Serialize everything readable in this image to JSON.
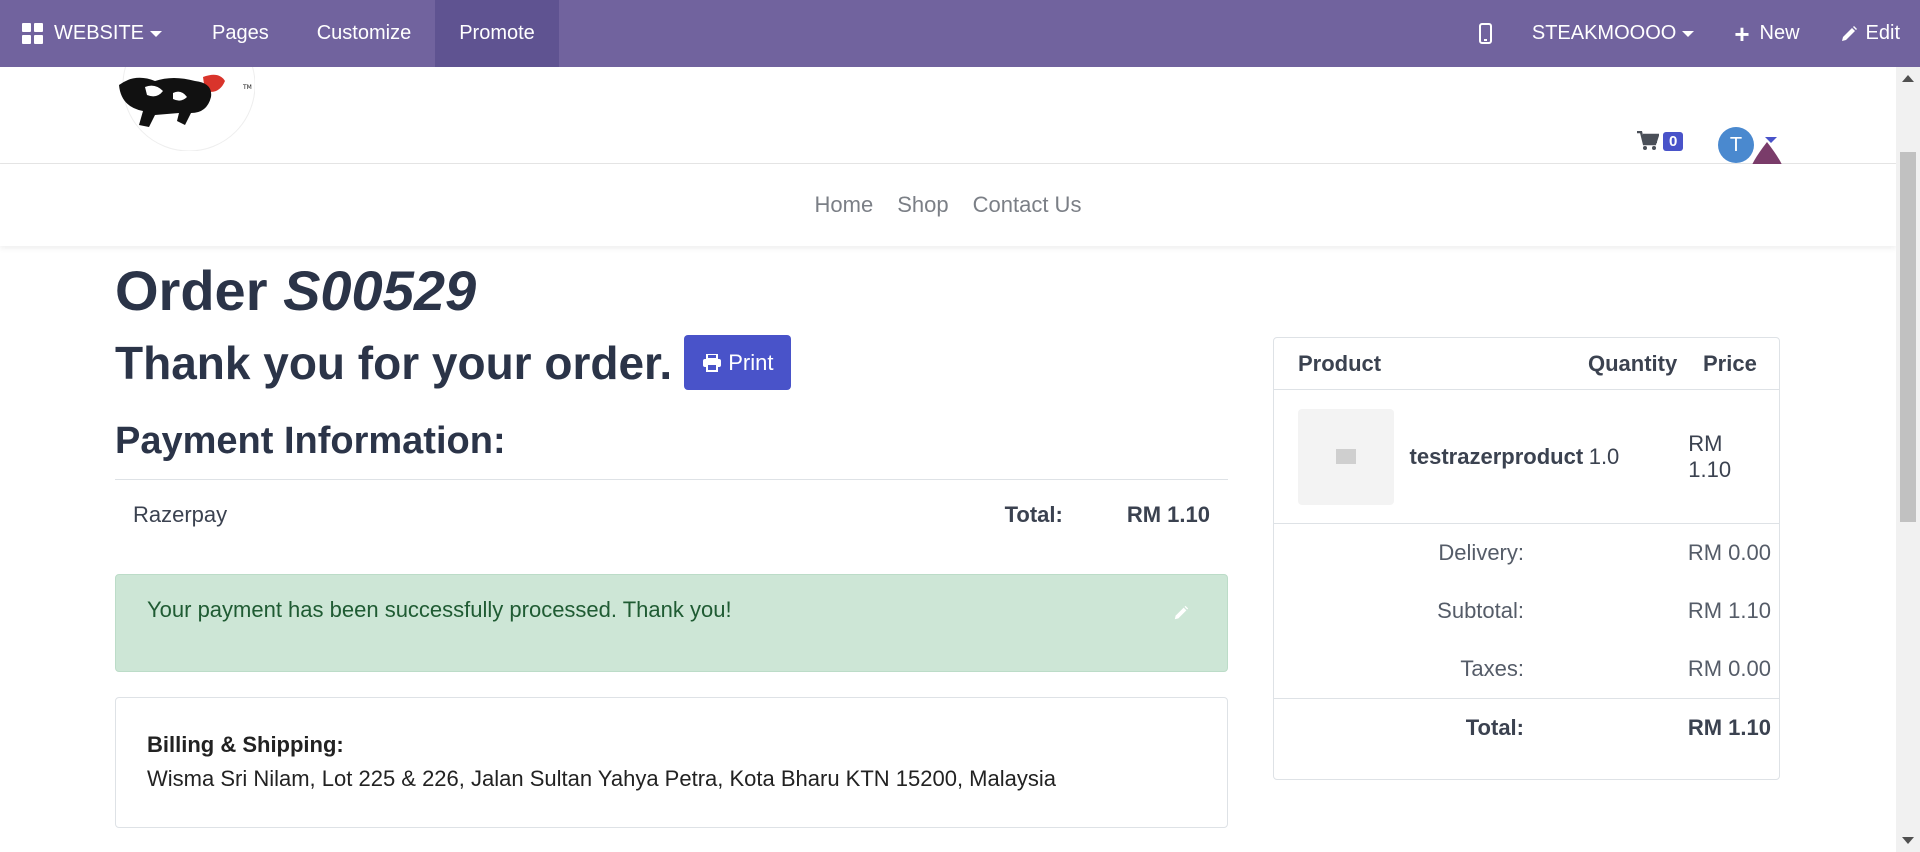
{
  "topbar": {
    "website_label": "WEBSITE",
    "pages_label": "Pages",
    "customize_label": "Customize",
    "promote_label": "Promote",
    "site_name": "STEAKMOOOO",
    "new_label": "New",
    "edit_label": "Edit"
  },
  "header": {
    "cart_count": "0",
    "avatar_initial": "T"
  },
  "nav": {
    "items": [
      "Home",
      "Shop",
      "Contact Us"
    ]
  },
  "order": {
    "title_prefix": "Order",
    "number": "S00529",
    "thanks": "Thank you for your order.",
    "print_label": "Print"
  },
  "payment": {
    "title": "Payment Information:",
    "method": "Razerpay",
    "total_label": "Total:",
    "total_value": "RM 1.10",
    "success_message": "Your payment has been successfully processed. Thank you!"
  },
  "billing": {
    "label": "Billing & Shipping:",
    "address": "Wisma Sri Nilam, Lot 225 & 226, Jalan Sultan Yahya Petra, Kota Bharu KTN 15200, Malaysia"
  },
  "summary": {
    "headers": {
      "product": "Product",
      "quantity": "Quantity",
      "price": "Price"
    },
    "items": [
      {
        "name": "testrazerproduct",
        "quantity": "1.0",
        "price": "RM 1.10"
      }
    ],
    "delivery_label": "Delivery:",
    "delivery_value": "RM 0.00",
    "subtotal_label": "Subtotal:",
    "subtotal_value": "RM 1.10",
    "taxes_label": "Taxes:",
    "taxes_value": "RM 0.00",
    "total_label": "Total:",
    "total_value": "RM 1.10"
  },
  "colors": {
    "topbar": "#71639e",
    "primary": "#4953c9",
    "success_bg": "#cde6d6"
  }
}
